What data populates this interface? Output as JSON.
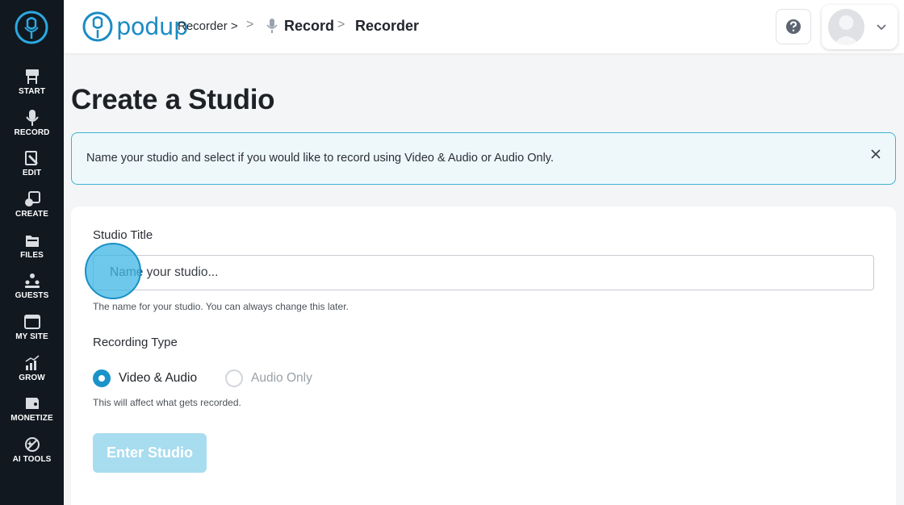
{
  "colors": {
    "accent": "#1b93c9",
    "sidebar_bg": "#111820",
    "alert_border": "#3fb3d0",
    "button_disabled": "#a8dcef"
  },
  "sidebar": {
    "items": [
      {
        "label": "START",
        "icon": "start-sign-icon"
      },
      {
        "label": "RECORD",
        "icon": "microphone-icon"
      },
      {
        "label": "EDIT",
        "icon": "edit-icon"
      },
      {
        "label": "CREATE",
        "icon": "create-icon"
      },
      {
        "label": "FILES",
        "icon": "files-icon"
      },
      {
        "label": "GUESTS",
        "icon": "guests-icon"
      },
      {
        "label": "MY SITE",
        "icon": "my-site-icon"
      },
      {
        "label": "GROW",
        "icon": "grow-chart-icon"
      },
      {
        "label": "MONETIZE",
        "icon": "monetize-icon"
      },
      {
        "label": "AI TOOLS",
        "icon": "ai-tools-icon"
      }
    ]
  },
  "header": {
    "brand": "podup",
    "breadcrumb": {
      "root": "Recorder >",
      "sep1": ">",
      "item1": "Record",
      "sep2": ">",
      "item2": "Recorder"
    }
  },
  "page": {
    "title": "Create a Studio"
  },
  "alert": {
    "text": "Name your studio and select if you would like to record using Video & Audio or Audio Only."
  },
  "form": {
    "title_label": "Studio Title",
    "title_value": "",
    "title_placeholder": "Name your studio...",
    "title_help": "The name for your studio. You can always change this later.",
    "type_label": "Recording Type",
    "options": [
      {
        "label": "Video & Audio",
        "selected": true
      },
      {
        "label": "Audio Only",
        "selected": false
      }
    ],
    "type_help": "This will affect what gets recorded.",
    "submit_label": "Enter Studio"
  }
}
